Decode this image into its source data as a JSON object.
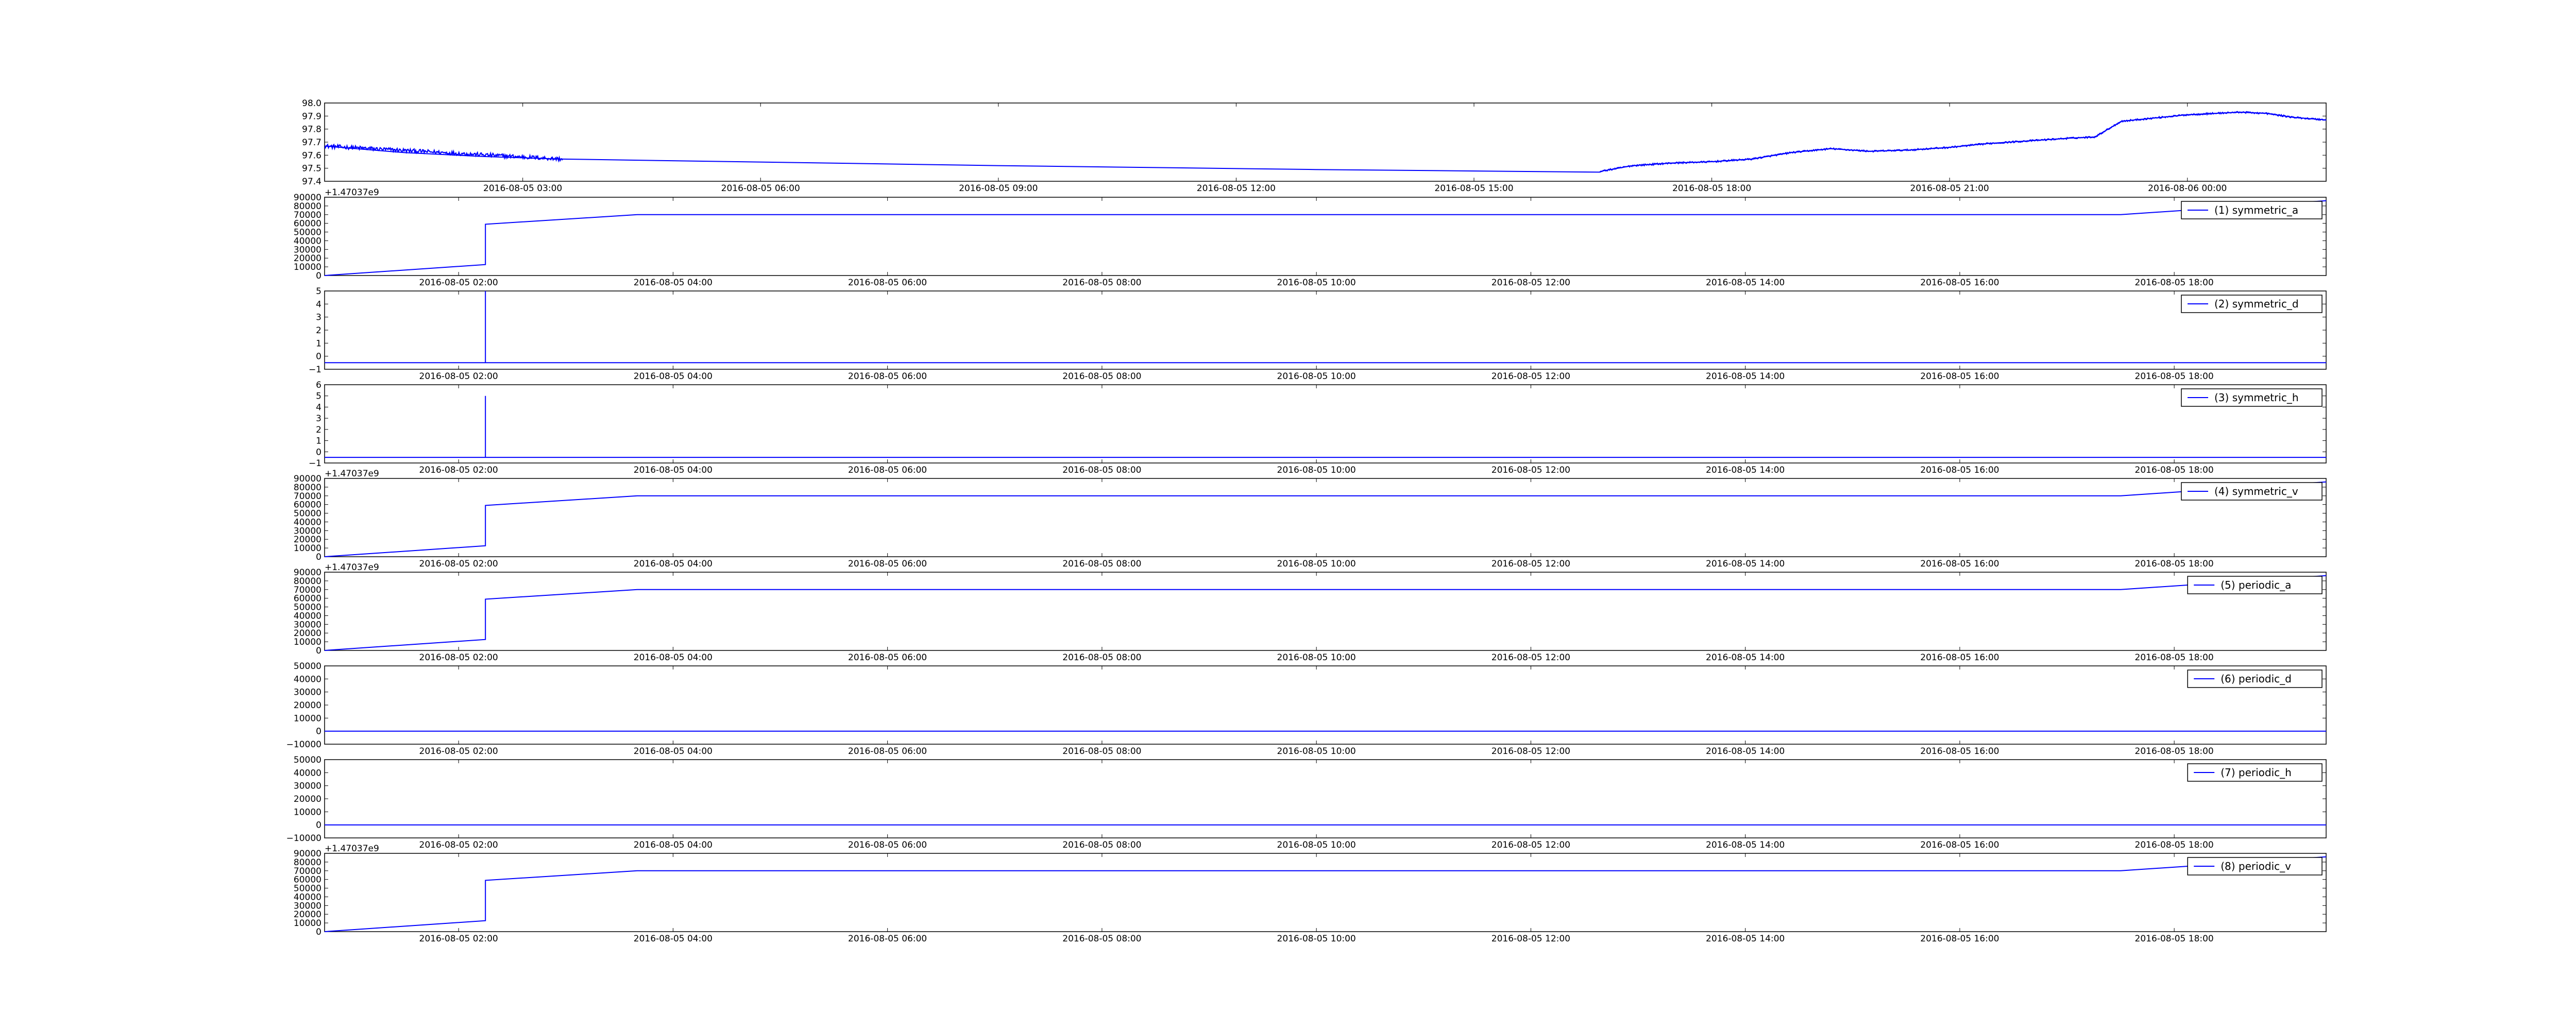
{
  "chart_data": [
    {
      "type": "line",
      "panel": 0,
      "legend": "",
      "offset_label": "",
      "ylim": [
        97.4,
        98.0
      ],
      "yticks": [
        "97.4",
        "97.5",
        "97.6",
        "97.7",
        "97.8",
        "97.9",
        "98.0"
      ],
      "xlim": [
        "2016-08-05 00:30",
        "2016-08-06 01:45"
      ],
      "xticks": [
        "2016-08-05 03:00",
        "2016-08-05 06:00",
        "2016-08-05 09:00",
        "2016-08-05 12:00",
        "2016-08-05 15:00",
        "2016-08-05 18:00",
        "2016-08-05 21:00",
        "2016-08-06 00:00"
      ],
      "color": "#0000ff",
      "noisy_segments": [
        {
          "x_start": "2016-08-05 00:30",
          "x_end": "2016-08-05 03:30",
          "y_start": 97.67,
          "y_end": 97.57,
          "noise": 0.015
        },
        {
          "x_start": "2016-08-05 16:35",
          "x_end": "2016-08-06 01:45",
          "noise": 0.006
        }
      ],
      "series": [
        {
          "x": [
            "2016-08-05 00:30",
            "2016-08-05 01:30",
            "2016-08-05 02:30",
            "2016-08-05 03:30",
            "2016-08-05 09:00",
            "2016-08-05 13:00",
            "2016-08-05 16:35",
            "2016-08-05 16:38",
            "2016-08-05 17:00",
            "2016-08-05 17:30",
            "2016-08-05 18:00",
            "2016-08-05 18:30",
            "2016-08-05 19:00",
            "2016-08-05 19:30",
            "2016-08-05 20:00",
            "2016-08-05 20:30",
            "2016-08-05 21:00",
            "2016-08-05 21:30",
            "2016-08-05 22:00",
            "2016-08-05 22:30",
            "2016-08-05 22:50",
            "2016-08-05 23:10",
            "2016-08-05 23:40",
            "2016-08-06 00:00",
            "2016-08-06 00:20",
            "2016-08-06 00:40",
            "2016-08-06 01:00",
            "2016-08-06 01:20",
            "2016-08-06 01:45"
          ],
          "values": [
            97.67,
            97.62,
            97.59,
            97.57,
            97.52,
            97.49,
            97.47,
            97.48,
            97.52,
            97.54,
            97.55,
            97.57,
            97.62,
            97.65,
            97.63,
            97.64,
            97.66,
            97.69,
            97.71,
            97.73,
            97.74,
            97.86,
            97.89,
            97.91,
            97.92,
            97.93,
            97.92,
            97.89,
            97.87
          ]
        }
      ]
    },
    {
      "type": "line",
      "panel": 1,
      "legend": "(1) symmetric_a",
      "offset_label": "+1.47037e9",
      "ylim": [
        0,
        90000
      ],
      "yticks": [
        "0",
        "10000",
        "20000",
        "30000",
        "40000",
        "50000",
        "60000",
        "70000",
        "80000",
        "90000"
      ],
      "xlim": [
        "2016-08-05 00:45",
        "2016-08-05 19:25"
      ],
      "xticks": [
        "2016-08-05 02:00",
        "2016-08-05 04:00",
        "2016-08-05 06:00",
        "2016-08-05 08:00",
        "2016-08-05 10:00",
        "2016-08-05 12:00",
        "2016-08-05 14:00",
        "2016-08-05 16:00",
        "2016-08-05 18:00"
      ],
      "color": "#0000ff",
      "series": [
        {
          "x": [
            "2016-08-05 00:45",
            "2016-08-05 02:15",
            "2016-08-05 02:15",
            "2016-08-05 03:40",
            "2016-08-05 17:30",
            "2016-08-05 19:25"
          ],
          "values": [
            0,
            12600,
            59000,
            70000,
            70000,
            86000
          ]
        }
      ]
    },
    {
      "type": "line",
      "panel": 2,
      "legend": "(2) symmetric_d",
      "offset_label": "",
      "ylim": [
        -1,
        5
      ],
      "yticks": [
        "−1",
        "0",
        "1",
        "2",
        "3",
        "4",
        "5"
      ],
      "xlim": [
        "2016-08-05 00:45",
        "2016-08-05 19:25"
      ],
      "xticks": [
        "2016-08-05 02:00",
        "2016-08-05 04:00",
        "2016-08-05 06:00",
        "2016-08-05 08:00",
        "2016-08-05 10:00",
        "2016-08-05 12:00",
        "2016-08-05 14:00",
        "2016-08-05 16:00",
        "2016-08-05 18:00"
      ],
      "color": "#0000ff",
      "series": [
        {
          "x": [
            "2016-08-05 00:45",
            "2016-08-05 02:15",
            "2016-08-05 02:15",
            "2016-08-05 02:15",
            "2016-08-05 19:25"
          ],
          "values": [
            -0.5,
            -0.5,
            5,
            -0.5,
            -0.5
          ]
        }
      ]
    },
    {
      "type": "line",
      "panel": 3,
      "legend": "(3) symmetric_h",
      "offset_label": "",
      "ylim": [
        -1,
        6
      ],
      "yticks": [
        "−1",
        "0",
        "1",
        "2",
        "3",
        "4",
        "5",
        "6"
      ],
      "xlim": [
        "2016-08-05 00:45",
        "2016-08-05 19:25"
      ],
      "xticks": [
        "2016-08-05 02:00",
        "2016-08-05 04:00",
        "2016-08-05 06:00",
        "2016-08-05 08:00",
        "2016-08-05 10:00",
        "2016-08-05 12:00",
        "2016-08-05 14:00",
        "2016-08-05 16:00",
        "2016-08-05 18:00"
      ],
      "color": "#0000ff",
      "series": [
        {
          "x": [
            "2016-08-05 00:45",
            "2016-08-05 02:15",
            "2016-08-05 02:15",
            "2016-08-05 02:15",
            "2016-08-05 19:25"
          ],
          "values": [
            -0.5,
            -0.5,
            5,
            -0.5,
            -0.5
          ]
        }
      ]
    },
    {
      "type": "line",
      "panel": 4,
      "legend": "(4) symmetric_v",
      "offset_label": "+1.47037e9",
      "ylim": [
        0,
        90000
      ],
      "yticks": [
        "0",
        "10000",
        "20000",
        "30000",
        "40000",
        "50000",
        "60000",
        "70000",
        "80000",
        "90000"
      ],
      "xlim": [
        "2016-08-05 00:45",
        "2016-08-05 19:25"
      ],
      "xticks": [
        "2016-08-05 02:00",
        "2016-08-05 04:00",
        "2016-08-05 06:00",
        "2016-08-05 08:00",
        "2016-08-05 10:00",
        "2016-08-05 12:00",
        "2016-08-05 14:00",
        "2016-08-05 16:00",
        "2016-08-05 18:00"
      ],
      "color": "#0000ff",
      "series": [
        {
          "x": [
            "2016-08-05 00:45",
            "2016-08-05 02:15",
            "2016-08-05 02:15",
            "2016-08-05 03:40",
            "2016-08-05 17:30",
            "2016-08-05 19:25"
          ],
          "values": [
            0,
            12600,
            59000,
            70000,
            70000,
            86000
          ]
        }
      ]
    },
    {
      "type": "line",
      "panel": 5,
      "legend": "(5) periodic_a",
      "offset_label": "+1.47037e9",
      "ylim": [
        0,
        90000
      ],
      "yticks": [
        "0",
        "10000",
        "20000",
        "30000",
        "40000",
        "50000",
        "60000",
        "70000",
        "80000",
        "90000"
      ],
      "xlim": [
        "2016-08-05 00:45",
        "2016-08-05 19:25"
      ],
      "xticks": [
        "2016-08-05 02:00",
        "2016-08-05 04:00",
        "2016-08-05 06:00",
        "2016-08-05 08:00",
        "2016-08-05 10:00",
        "2016-08-05 12:00",
        "2016-08-05 14:00",
        "2016-08-05 16:00",
        "2016-08-05 18:00"
      ],
      "color": "#0000ff",
      "series": [
        {
          "x": [
            "2016-08-05 00:45",
            "2016-08-05 02:15",
            "2016-08-05 02:15",
            "2016-08-05 03:40",
            "2016-08-05 17:30",
            "2016-08-05 19:25"
          ],
          "values": [
            0,
            12600,
            59000,
            70000,
            70000,
            86000
          ]
        }
      ]
    },
    {
      "type": "line",
      "panel": 6,
      "legend": "(6) periodic_d",
      "offset_label": "",
      "ylim": [
        -10000,
        50000
      ],
      "yticks": [
        "−10000",
        "0",
        "10000",
        "20000",
        "30000",
        "40000",
        "50000"
      ],
      "xlim": [
        "2016-08-05 00:45",
        "2016-08-05 19:25"
      ],
      "xticks": [
        "2016-08-05 02:00",
        "2016-08-05 04:00",
        "2016-08-05 06:00",
        "2016-08-05 08:00",
        "2016-08-05 10:00",
        "2016-08-05 12:00",
        "2016-08-05 14:00",
        "2016-08-05 16:00",
        "2016-08-05 18:00"
      ],
      "color": "#0000ff",
      "series": [
        {
          "x": [
            "2016-08-05 00:45",
            "2016-08-05 19:25"
          ],
          "values": [
            0,
            0
          ]
        }
      ]
    },
    {
      "type": "line",
      "panel": 7,
      "legend": "(7) periodic_h",
      "offset_label": "",
      "ylim": [
        -10000,
        50000
      ],
      "yticks": [
        "−10000",
        "0",
        "10000",
        "20000",
        "30000",
        "40000",
        "50000"
      ],
      "xlim": [
        "2016-08-05 00:45",
        "2016-08-05 19:25"
      ],
      "xticks": [
        "2016-08-05 02:00",
        "2016-08-05 04:00",
        "2016-08-05 06:00",
        "2016-08-05 08:00",
        "2016-08-05 10:00",
        "2016-08-05 12:00",
        "2016-08-05 14:00",
        "2016-08-05 16:00",
        "2016-08-05 18:00"
      ],
      "color": "#0000ff",
      "series": [
        {
          "x": [
            "2016-08-05 00:45",
            "2016-08-05 19:25"
          ],
          "values": [
            0,
            0
          ]
        }
      ]
    },
    {
      "type": "line",
      "panel": 8,
      "legend": "(8) periodic_v",
      "offset_label": "+1.47037e9",
      "ylim": [
        0,
        90000
      ],
      "yticks": [
        "0",
        "10000",
        "20000",
        "30000",
        "40000",
        "50000",
        "60000",
        "70000",
        "80000",
        "90000"
      ],
      "xlim": [
        "2016-08-05 00:45",
        "2016-08-05 19:25"
      ],
      "xticks": [
        "2016-08-05 02:00",
        "2016-08-05 04:00",
        "2016-08-05 06:00",
        "2016-08-05 08:00",
        "2016-08-05 10:00",
        "2016-08-05 12:00",
        "2016-08-05 14:00",
        "2016-08-05 16:00",
        "2016-08-05 18:00"
      ],
      "color": "#0000ff",
      "series": [
        {
          "x": [
            "2016-08-05 00:45",
            "2016-08-05 02:15",
            "2016-08-05 02:15",
            "2016-08-05 03:40",
            "2016-08-05 17:30",
            "2016-08-05 19:25"
          ],
          "values": [
            0,
            12600,
            59000,
            70000,
            70000,
            86000
          ]
        }
      ]
    }
  ]
}
